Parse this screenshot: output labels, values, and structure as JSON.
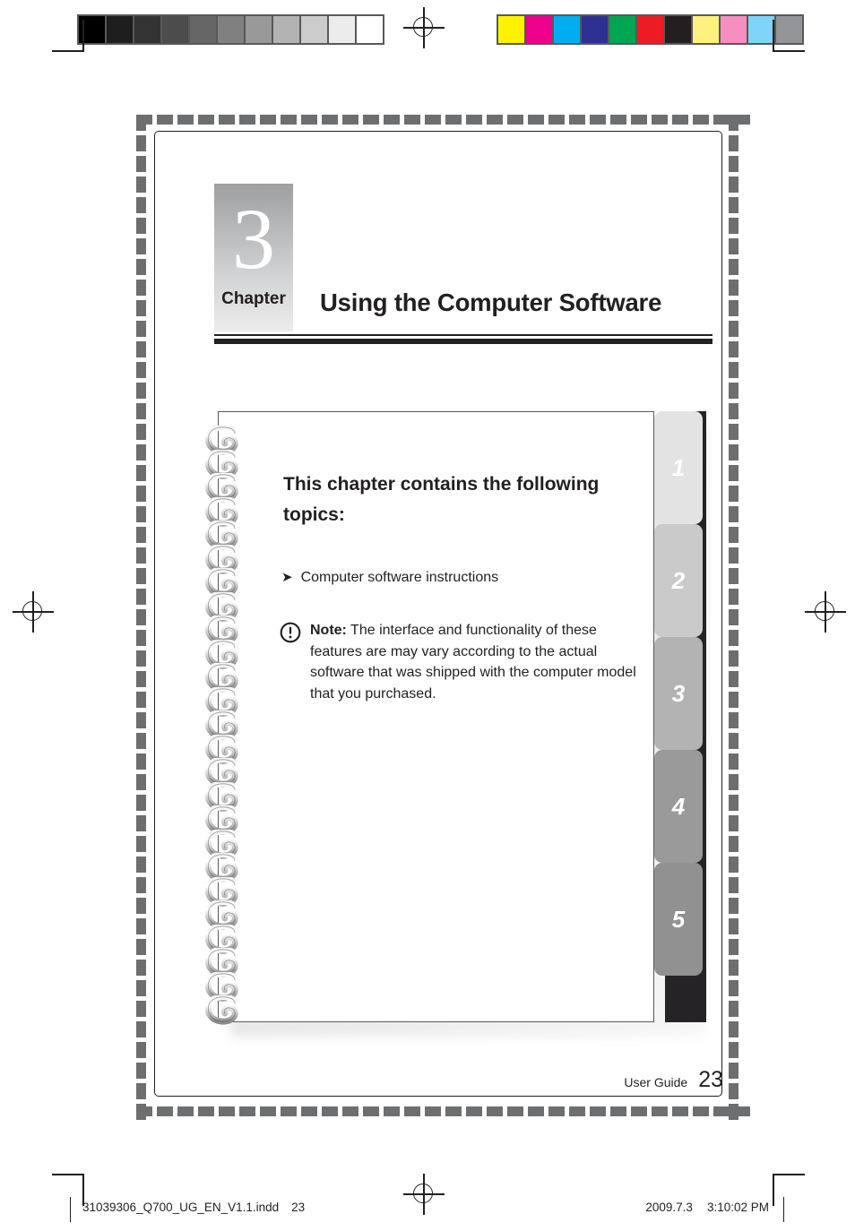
{
  "document": {
    "page_number": "23",
    "footer_label": "User Guide"
  },
  "chapter": {
    "number": "3",
    "word": "Chapter",
    "title": "Using the Computer Software"
  },
  "panel": {
    "heading": "This chapter contains the following topics:",
    "topics": [
      {
        "arrow": "arrow-bullet-icon",
        "text": "Computer software instructions"
      }
    ],
    "note": {
      "icon": "exclamation-circle-icon",
      "label": "Note:",
      "body": " The interface and functionality of these features are may vary according to the actual software that was shipped with the computer model that you purchased."
    }
  },
  "side_tabs": [
    {
      "label": "1",
      "color": "#e3e3e3"
    },
    {
      "label": "2",
      "color": "#cacaca"
    },
    {
      "label": "3",
      "color": "#b3b3b3"
    },
    {
      "label": "4",
      "color": "#9a9a9a"
    },
    {
      "label": "5",
      "color": "#919191"
    }
  ],
  "tab_spine_color": "#262326",
  "slug": {
    "filename": "31039306_Q700_UG_EN_V1.1.indd",
    "page": "23",
    "date": "2009.7.3",
    "time": "3:10:02 PM"
  },
  "calibration": {
    "gray_wedge": [
      "#000000",
      "#1e1e1e",
      "#333333",
      "#4c4c4c",
      "#666666",
      "#808080",
      "#999999",
      "#b3b3b3",
      "#cccccc",
      "#ececec",
      "#ffffff"
    ],
    "color_wedge": [
      "#fff200",
      "#ec008c",
      "#00aeef",
      "#2e3192",
      "#00a651",
      "#ed1c24",
      "#231f20",
      "#fff17f",
      "#f48fc0",
      "#7fd4f7",
      "#939598"
    ],
    "frame_color": "#58595b",
    "registration_marks": 4,
    "crop_marks": 4
  }
}
